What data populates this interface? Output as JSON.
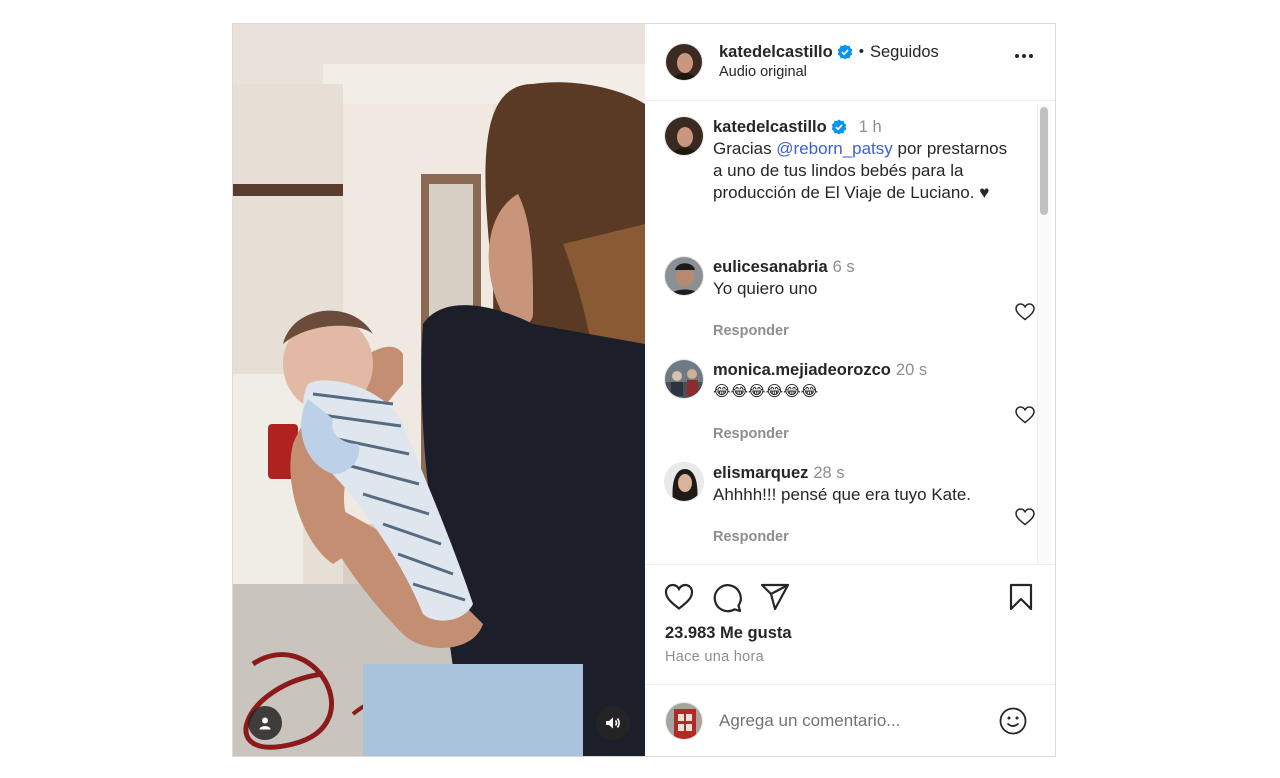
{
  "post": {
    "author": "katedelcastillo",
    "follow_status": "Seguidos",
    "separator": "•",
    "audio": "Audio original",
    "caption": {
      "user": "katedelcastillo",
      "time": "1 h",
      "text_before": "Gracias ",
      "mention": "@reborn_patsy",
      "text_after": " por prestarnos a uno de tus lindos bebés para la producción de El Viaje de Luciano. ♥"
    },
    "comments": [
      {
        "user": "eulicesanabria",
        "time": "6 s",
        "text": "Yo quiero uno",
        "reply": "Responder"
      },
      {
        "user": "monica.mejiadeorozco",
        "time": "20 s",
        "text": "😂😂😂😂😂😂",
        "reply": "Responder"
      },
      {
        "user": "elismarquez",
        "time": "28 s",
        "text": "Ahhhh!!! pensé que era tuyo Kate.",
        "reply": "Responder"
      }
    ],
    "likes": "23.983 Me gusta",
    "posted": "Hace una hora",
    "comment_placeholder": "Agrega un comentario...",
    "icons": {
      "like": "heart-icon",
      "comment": "comment-bubble-icon",
      "share": "paper-plane-icon",
      "save": "bookmark-icon",
      "verified": "verified-badge-icon",
      "more": "more-options-icon",
      "emoji": "emoji-icon",
      "tags": "user-tag-icon",
      "audio": "speaker-icon"
    },
    "colors": {
      "verified": "#0095f6",
      "mention": "#3b5fd9",
      "muted": "#8e8e8e"
    }
  }
}
